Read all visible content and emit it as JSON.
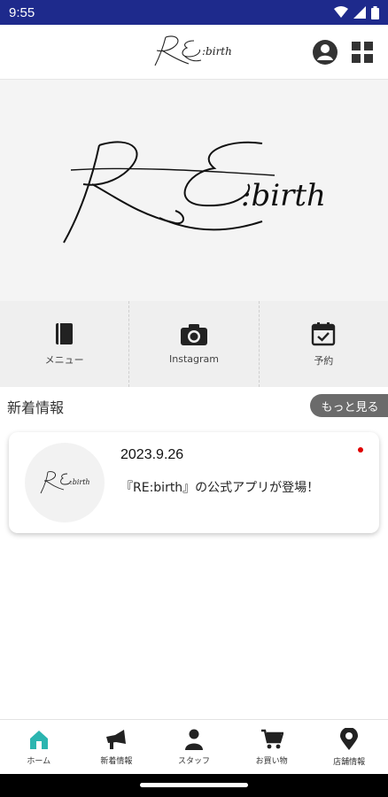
{
  "status_bar": {
    "time": "9:55",
    "icons": [
      "wifi-icon",
      "cellular-icon",
      "battery-icon"
    ]
  },
  "header": {
    "logo_text": "RE:birth",
    "buttons": [
      "account-icon",
      "grid-menu-icon"
    ]
  },
  "hero": {
    "logo_text": "RE:birth"
  },
  "quick_menu": [
    {
      "label": "メニュー",
      "icon": "book-icon"
    },
    {
      "label": "Instagram",
      "icon": "camera-icon"
    },
    {
      "label": "予約",
      "icon": "calendar-check-icon"
    }
  ],
  "news": {
    "section_title": "新着情報",
    "more_label": "もっと見る",
    "items": [
      {
        "date": "2023.9.26",
        "text": "『RE:birth』の公式アプリが登場！",
        "unread": true
      }
    ]
  },
  "bottom_nav": [
    {
      "label": "ホーム",
      "icon": "home-icon",
      "active": true
    },
    {
      "label": "新着情報",
      "icon": "megaphone-icon",
      "active": false
    },
    {
      "label": "スタッフ",
      "icon": "person-icon",
      "active": false
    },
    {
      "label": "お買い物",
      "icon": "cart-icon",
      "active": false
    },
    {
      "label": "店舗情報",
      "icon": "location-pin-icon",
      "active": false
    }
  ],
  "colors": {
    "status_bar": "#1e2a8c",
    "active_tab": "#2bb5b0",
    "more_button": "#6b6b6b",
    "unread_dot": "#e00000"
  }
}
